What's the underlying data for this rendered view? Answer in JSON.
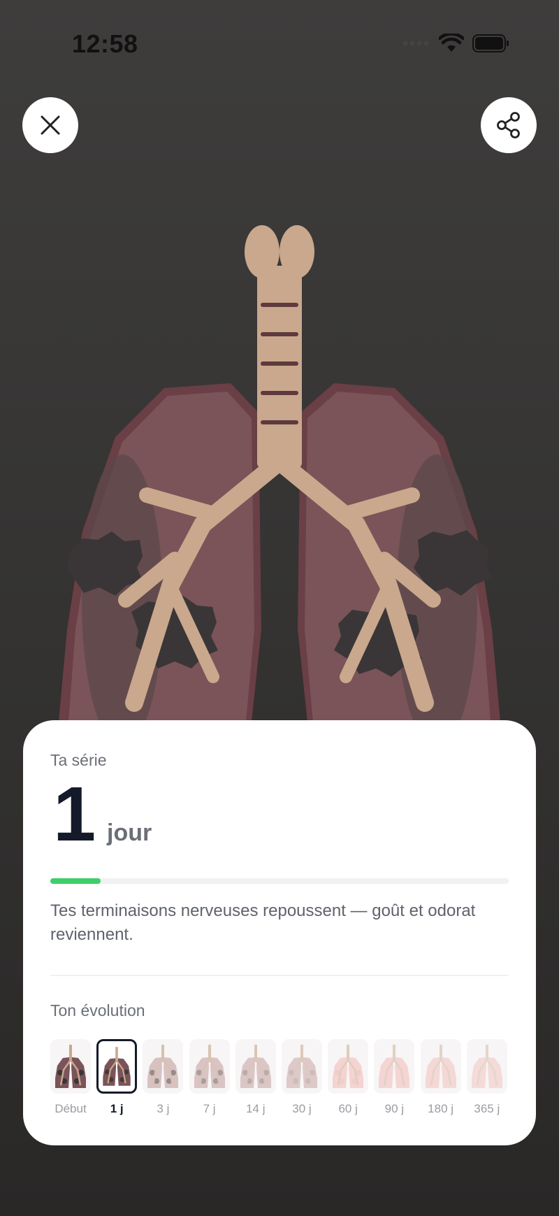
{
  "status_bar": {
    "time": "12:58",
    "icons": [
      "cellular-dots-icon",
      "wifi-icon",
      "battery-icon"
    ]
  },
  "top_buttons": {
    "close_icon": "close-icon",
    "share_icon": "share-icon"
  },
  "illustration": {
    "subject": "lungs-illustration"
  },
  "streak_card": {
    "title": "Ta série",
    "count": "1",
    "unit": "jour",
    "progress_fraction": 0.11,
    "message": "Tes terminaisons nerveuses repoussent — goût et odorat reviennent.",
    "evolution_title": "Ton évolution",
    "milestones": [
      {
        "label": "Début",
        "selected": false
      },
      {
        "label": "1 j",
        "selected": true
      },
      {
        "label": "3 j",
        "selected": false
      },
      {
        "label": "7 j",
        "selected": false
      },
      {
        "label": "14 j",
        "selected": false
      },
      {
        "label": "30 j",
        "selected": false
      },
      {
        "label": "60 j",
        "selected": false
      },
      {
        "label": "90 j",
        "selected": false
      },
      {
        "label": "180 j",
        "selected": false
      },
      {
        "label": "365 j",
        "selected": false
      }
    ]
  },
  "colors": {
    "background": "#363534",
    "lung": "#7a5459",
    "lung_edge": "#6a3f45",
    "airway": "#c9a88d",
    "tar": "#3a3637",
    "accent_green": "#3fcf6a",
    "text_dark": "#151a2a"
  }
}
